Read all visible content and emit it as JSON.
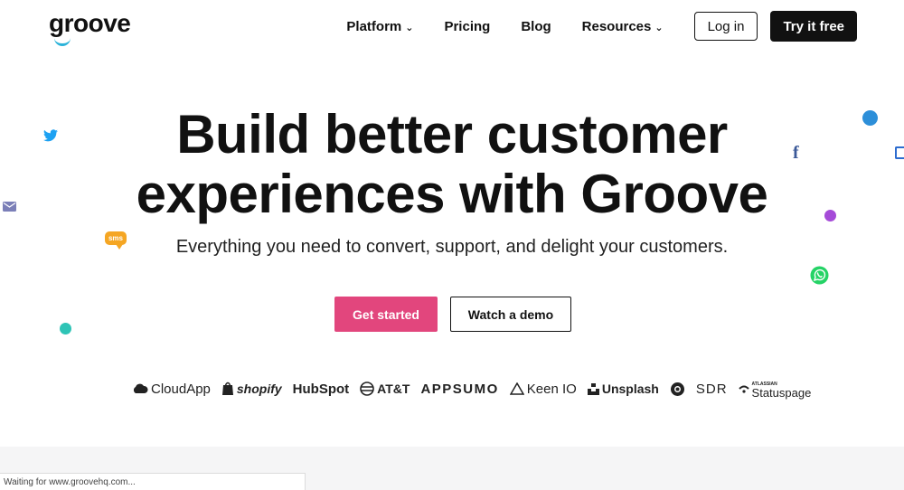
{
  "header": {
    "logo": "groove",
    "nav": [
      {
        "label": "Platform",
        "has_dropdown": true
      },
      {
        "label": "Pricing",
        "has_dropdown": false
      },
      {
        "label": "Blog",
        "has_dropdown": false
      },
      {
        "label": "Resources",
        "has_dropdown": true
      }
    ],
    "login_label": "Log in",
    "try_label": "Try it free"
  },
  "hero": {
    "headline_line1": "Build better customer",
    "headline_line2": "experiences with Groove",
    "subhead": "Everything you need to convert, support, and delight your customers.",
    "primary_cta": "Get started",
    "secondary_cta": "Watch a demo"
  },
  "brands": {
    "cloudapp": "CloudApp",
    "shopify": "shopify",
    "hubspot": "HubSpot",
    "att": "AT&T",
    "appsumo": "APPSUMO",
    "keenio": "Keen IO",
    "unsplash": "Unsplash",
    "sdr": "SDR",
    "statuspage": "Statuspage",
    "statuspage_small": "ATLASSIAN"
  },
  "floaters": {
    "sms_label": "sms",
    "facebook_label": "f"
  },
  "status_bar": {
    "text": "Waiting for www.groovehq.com..."
  },
  "colors": {
    "accent_pink": "#e2467d",
    "twitter": "#1da1f2",
    "facebook": "#3b5998",
    "teal": "#2ec4b6",
    "blue_dot": "#2d8fd9",
    "purple_dot": "#a54bd8",
    "whatsapp": "#25d366",
    "email": "#7b7fb8",
    "sms": "#f5a623"
  },
  "icons": [
    "twitter-icon",
    "email-icon",
    "sms-icon",
    "facebook-icon",
    "whatsapp-icon",
    "chevron-down-icon"
  ]
}
